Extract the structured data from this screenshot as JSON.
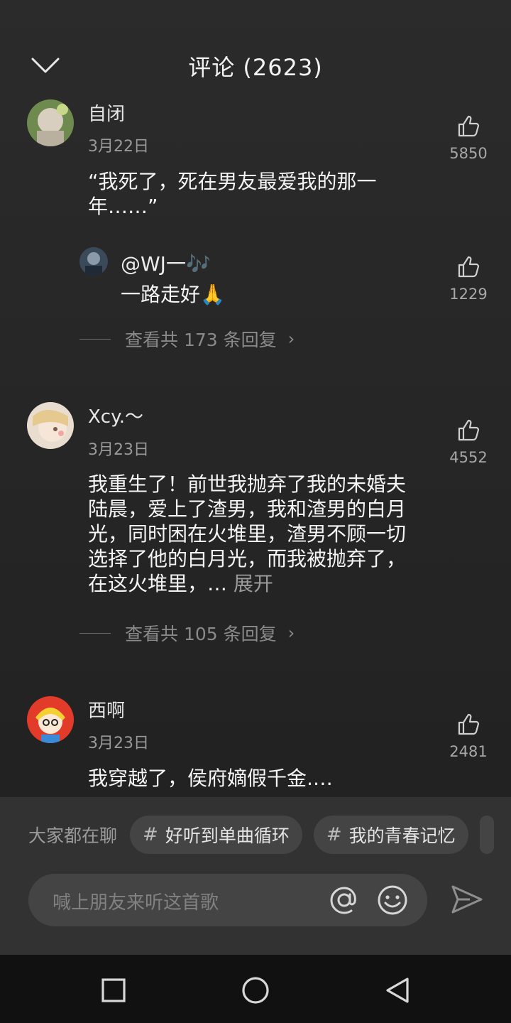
{
  "header": {
    "title": "评论 (2623)",
    "collapse_icon": "chevron-down-icon"
  },
  "comments": [
    {
      "username": "自闭",
      "date": "3月22日",
      "content": "“我死了，死在男友最爱我的那一年……”",
      "likes": "5850",
      "reply": {
        "username": "@WJ一🎶",
        "content": "一路走好🙏",
        "likes": "1229"
      },
      "view_replies": "查看共 173 条回复"
    },
    {
      "username": "Xcy.～",
      "date": "3月23日",
      "content": "我重生了！前世我抛弃了我的未婚夫陆晨，爱上了渣男，我和渣男的白月光，同时困在火堆里，渣男不顾一切选择了他的白月光，而我被抛弃了，在这火堆里，…",
      "expand": "展开",
      "likes": "4552",
      "view_replies": "查看共 105 条回复"
    },
    {
      "username": "西啊",
      "date": "3月23日",
      "content": "我穿越了，侯府嫡假千金.…",
      "likes": "2481"
    }
  ],
  "bottom": {
    "topics_label": "大家都在聊",
    "topics": [
      "好听到单曲循环",
      "我的青春记忆"
    ],
    "input_placeholder": "喊上朋友来听这首歌"
  },
  "icons": {
    "like": "thumbs-up-icon",
    "at": "at-sign-icon",
    "emoji": "smiley-icon",
    "send": "send-icon",
    "nav": [
      "square-icon",
      "circle-icon",
      "triangle-back-icon"
    ]
  },
  "colors": {
    "background": "#2b2b2b",
    "panel": "#323232",
    "chip": "#444444",
    "muted_text": "#9a9a9a"
  }
}
